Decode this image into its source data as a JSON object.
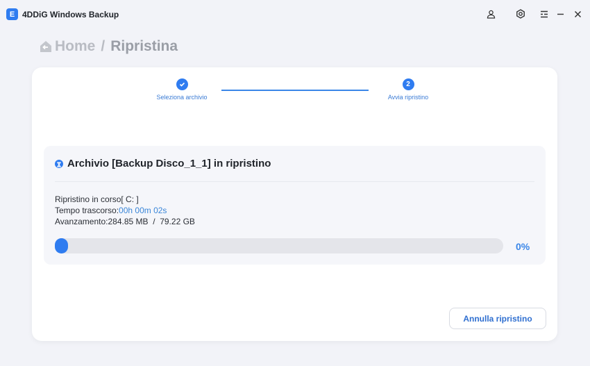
{
  "app": {
    "logo_letter": "E",
    "title": "4DDiG Windows Backup"
  },
  "breadcrumb": {
    "home": "Home",
    "separator": "/",
    "current": "Ripristina"
  },
  "steps": [
    {
      "label": "Seleziona archivio",
      "state": "done"
    },
    {
      "number": "2",
      "label": "Avvia ripristino",
      "state": "active"
    }
  ],
  "panel": {
    "title": "Archivio [Backup Disco_1_1] in ripristino",
    "status_label": "Ripristino in corso[ C:  ]",
    "elapsed_label": "Tempo trascorso:",
    "elapsed_value": "00h 00m 02s",
    "progress_label": "Avanzamento:",
    "progress_value": "284.85 MB  /  79.22 GB",
    "progress_percent": 0,
    "progress_text": "0%"
  },
  "buttons": {
    "cancel": "Annulla ripristino"
  },
  "colors": {
    "accent": "#2f7cf0",
    "background": "#f2f3f8"
  }
}
